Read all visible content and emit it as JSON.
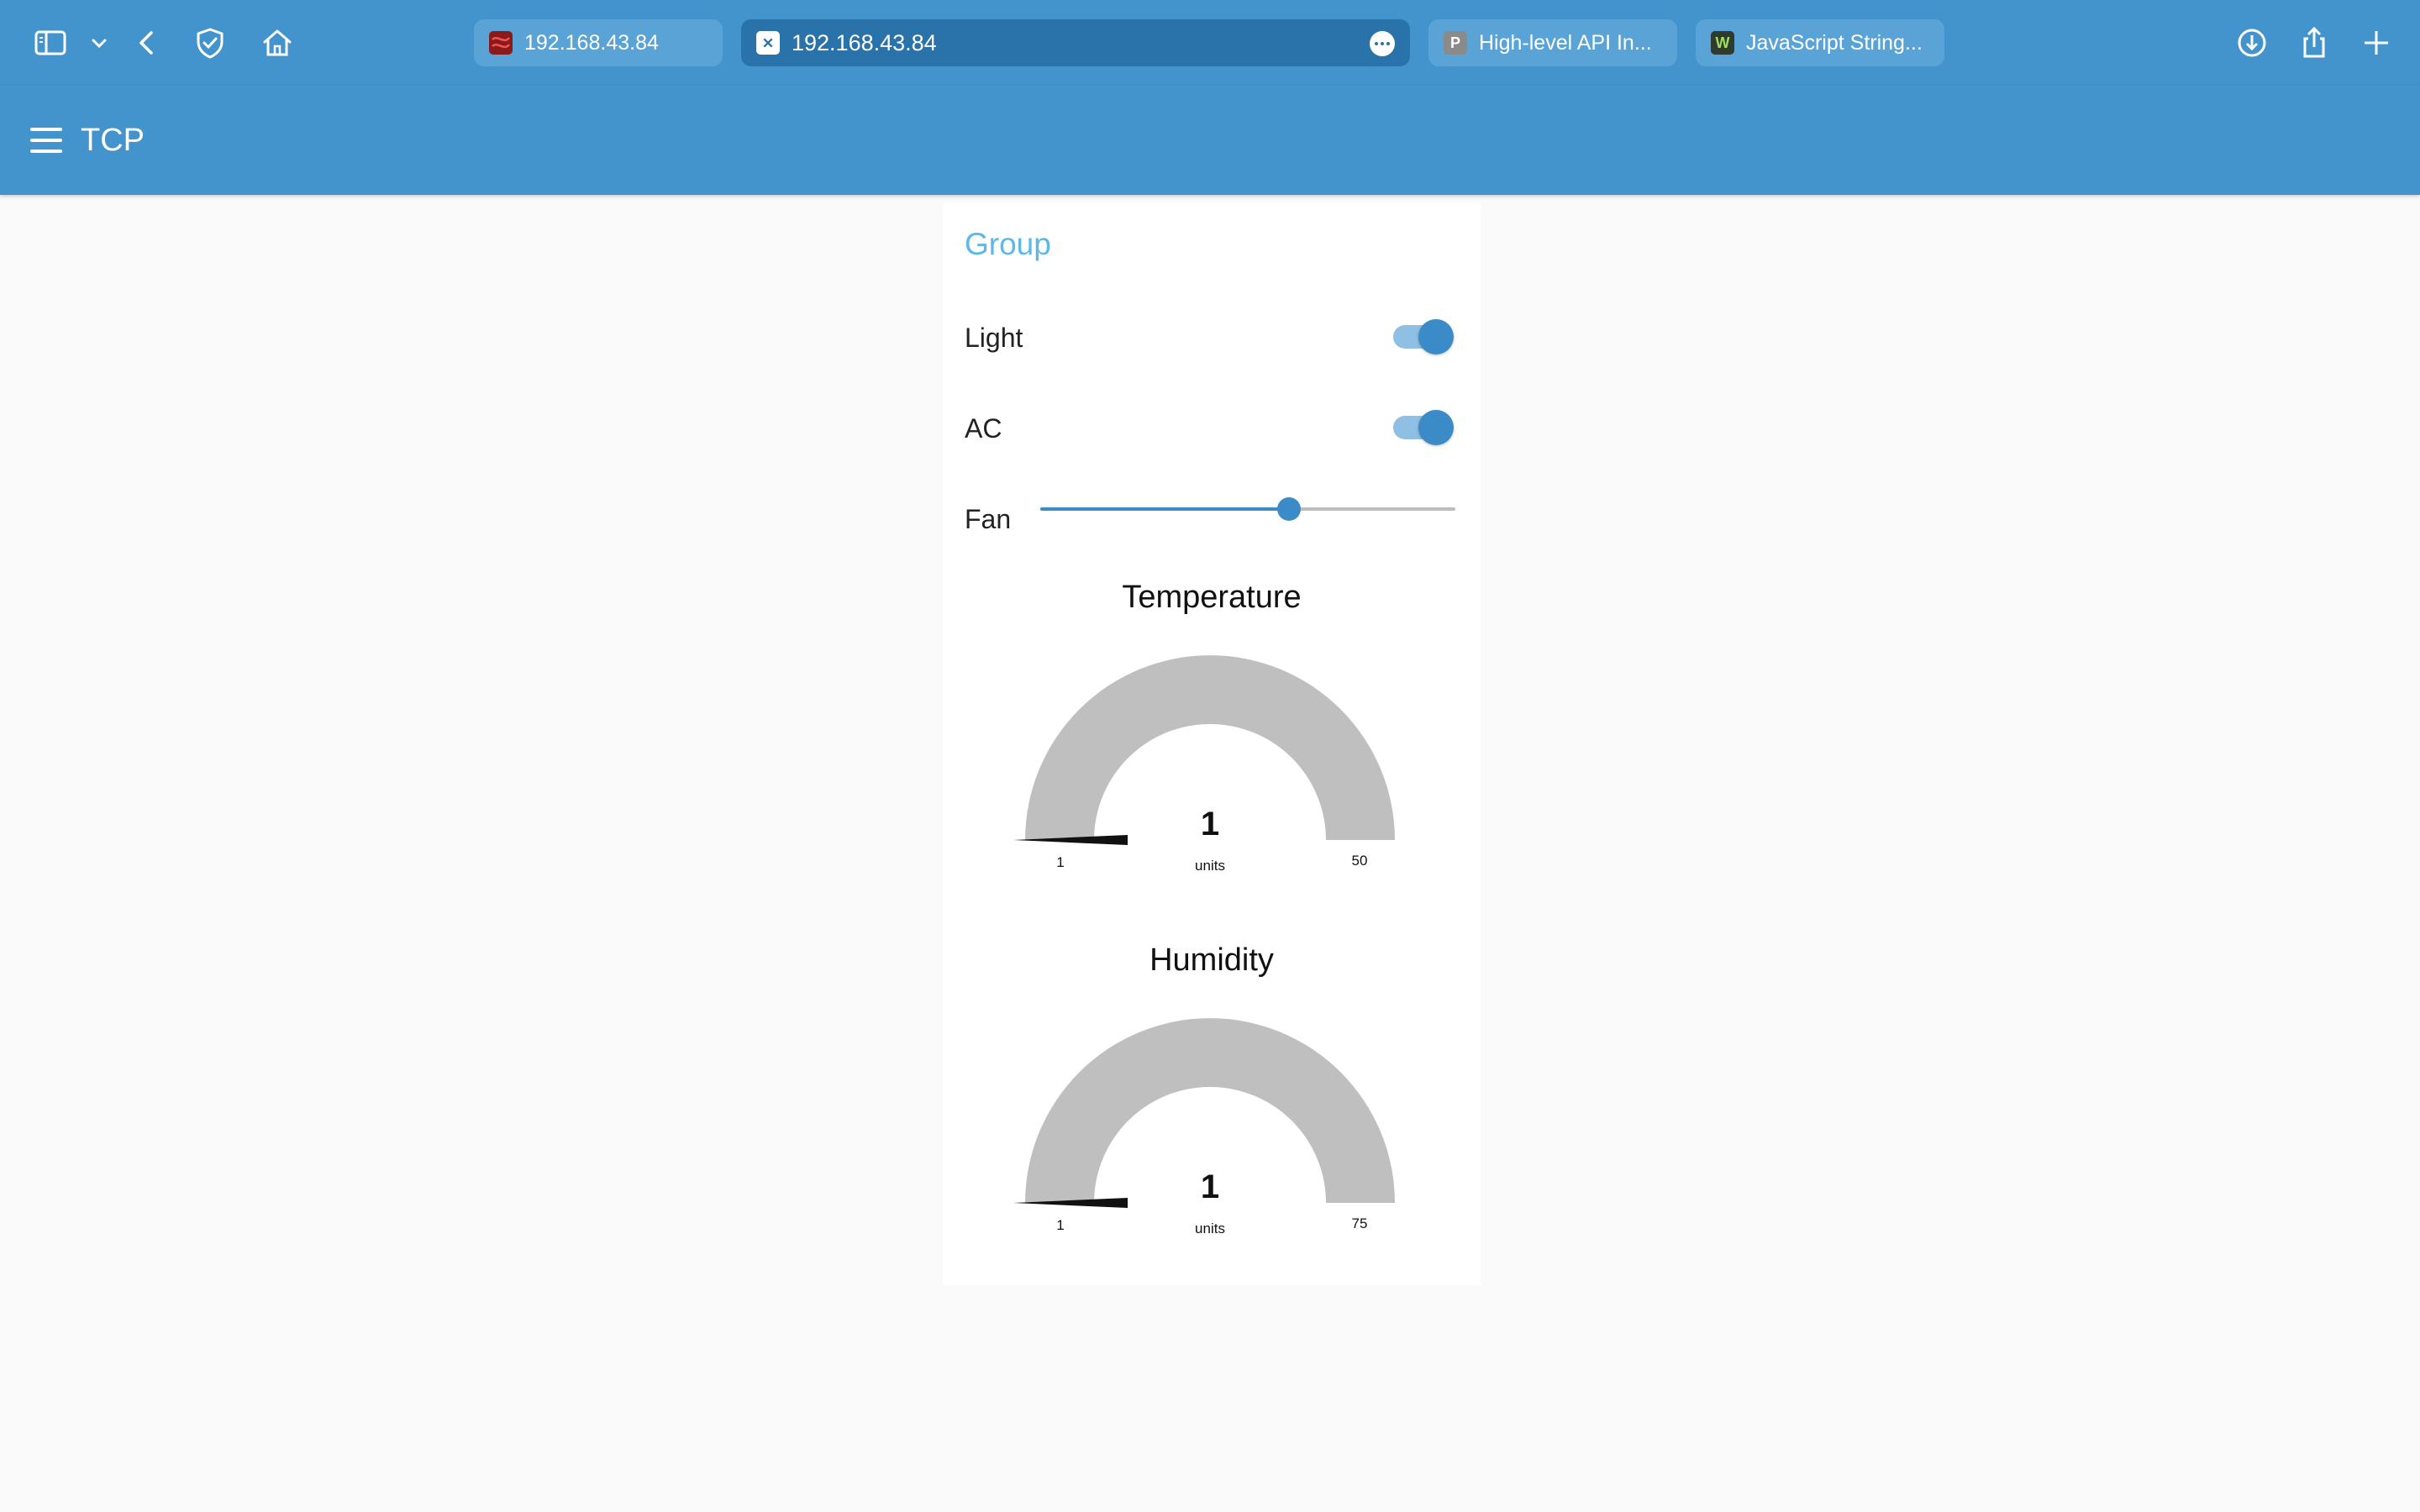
{
  "browser": {
    "tabs": [
      {
        "title": "192.168.43.84",
        "favicon_color": "#8b1a1a",
        "favicon_letter": ""
      },
      {
        "title": "192.168.43.84",
        "favicon_color": "#ffffff",
        "favicon_letter": "",
        "active": true
      },
      {
        "title": "High-level API In...",
        "favicon_color": "#8a8a8a",
        "favicon_letter": "P"
      },
      {
        "title": "JavaScript String...",
        "favicon_color": "#2e3b2e",
        "favicon_letter": "W"
      }
    ],
    "icons": [
      "sidebar-icon",
      "chevron-down-icon",
      "back-icon",
      "shield-icon",
      "home-icon",
      "download-icon",
      "share-icon",
      "plus-icon"
    ]
  },
  "header": {
    "title": "TCP"
  },
  "group": {
    "title": "Group",
    "light": {
      "label": "Light",
      "on": true
    },
    "ac": {
      "label": "AC",
      "on": true
    },
    "fan": {
      "label": "Fan",
      "value_fraction": 0.6
    }
  },
  "gauges": [
    {
      "title": "Temperature",
      "value": "1",
      "units": "units",
      "min": "1",
      "max": "50"
    },
    {
      "title": "Humidity",
      "value": "1",
      "units": "units",
      "min": "1",
      "max": "75"
    }
  ],
  "colors": {
    "accent": "#4393cc",
    "group_title": "#5bb8e8",
    "gauge_fill": "#bfbfbf"
  }
}
